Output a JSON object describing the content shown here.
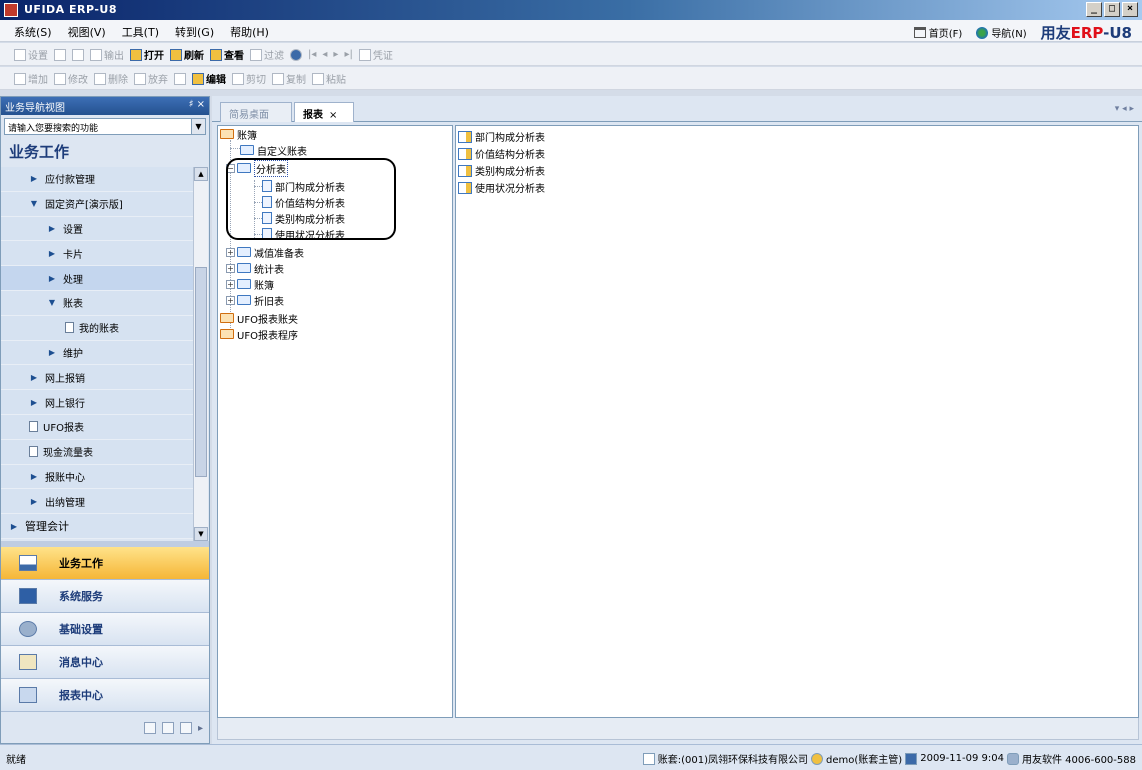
{
  "window": {
    "title": "UFIDA ERP-U8",
    "controls": [
      "_",
      "□",
      "×"
    ]
  },
  "menubar": {
    "items": [
      "系统(S)",
      "视图(V)",
      "工具(T)",
      "转到(G)",
      "帮助(H)"
    ],
    "home": "首页(F)",
    "navigate": "导航(N)",
    "brand_prefix": "用友",
    "brand_erp": "ERP",
    "brand_suffix": "-U8"
  },
  "toolbar1": {
    "items": [
      "设置",
      "",
      "",
      "输出",
      "打开",
      "刷新",
      "查看",
      "过滤",
      "",
      "",
      "",
      "",
      "",
      "凭证"
    ]
  },
  "toolbar2": {
    "items": [
      "增加",
      "修改",
      "删除",
      "放弃",
      "",
      "编辑",
      "剪切",
      "复制",
      "粘贴"
    ]
  },
  "nav": {
    "header": "业务导航视图",
    "header_controls": "♯ ×",
    "search_placeholder": "请输入您要搜索的功能",
    "section_title": "业务工作",
    "items": [
      {
        "label": "应付款管理",
        "level": 1,
        "type": "tri-right"
      },
      {
        "label": "固定资产[演示版]",
        "level": 1,
        "type": "tri-down"
      },
      {
        "label": "设置",
        "level": 2,
        "type": "tri-right"
      },
      {
        "label": "卡片",
        "level": 2,
        "type": "tri-right"
      },
      {
        "label": "处理",
        "level": 2,
        "type": "tri-right"
      },
      {
        "label": "账表",
        "level": 2,
        "type": "tri-down"
      },
      {
        "label": "我的账表",
        "level": 3,
        "type": "doc"
      },
      {
        "label": "维护",
        "level": 2,
        "type": "tri-right"
      },
      {
        "label": "网上报销",
        "level": 1,
        "type": "tri-right"
      },
      {
        "label": "网上银行",
        "level": 1,
        "type": "tri-right"
      },
      {
        "label": "UFO报表",
        "level": 1,
        "type": "doc"
      },
      {
        "label": "现金流量表",
        "level": 1,
        "type": "doc"
      },
      {
        "label": "报账中心",
        "level": 1,
        "type": "tri-right"
      },
      {
        "label": "出纳管理",
        "level": 1,
        "type": "tri-right"
      },
      {
        "label": "管理会计",
        "level": 0,
        "type": "tri-right"
      }
    ],
    "buttons": [
      {
        "label": "业务工作",
        "active": true,
        "icon": "chart-icon"
      },
      {
        "label": "系统服务",
        "active": false,
        "icon": "monitor-icon"
      },
      {
        "label": "基础设置",
        "active": false,
        "icon": "gear-icon"
      },
      {
        "label": "消息中心",
        "active": false,
        "icon": "message-icon"
      },
      {
        "label": "报表中心",
        "active": false,
        "icon": "report-icon"
      }
    ]
  },
  "tabs": [
    {
      "label": "简易桌面",
      "active": false
    },
    {
      "label": "报表",
      "active": true
    }
  ],
  "tree": {
    "root": "账簿",
    "custom": "自定义账表",
    "analysis": "分析表",
    "analysis_children": [
      "部门构成分析表",
      "价值结构分析表",
      "类别构成分析表",
      "使用状况分析表"
    ],
    "others": [
      "减值准备表",
      "统计表",
      "账簿",
      "折旧表"
    ],
    "ufo1": "UFO报表账夹",
    "ufo2": "UFO报表程序"
  },
  "list": {
    "items": [
      "部门构成分析表",
      "价值结构分析表",
      "类别构成分析表",
      "使用状况分析表"
    ]
  },
  "status": {
    "left": "就绪",
    "account": "账套:(001)凤翎环保科技有限公司",
    "user": "demo(账套主管)",
    "datetime": "2009-11-09 9:04",
    "support": "用友软件 4006-600-588"
  }
}
